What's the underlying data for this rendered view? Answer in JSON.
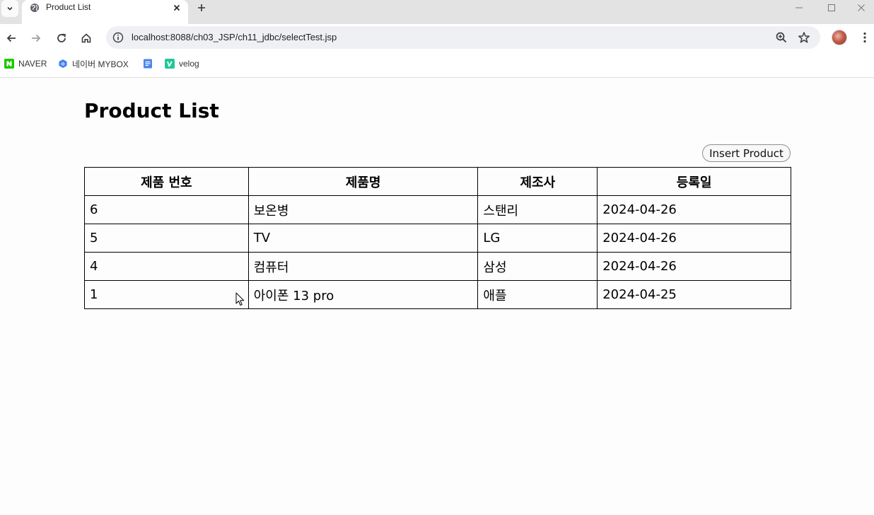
{
  "browser": {
    "tab_title": "Product List",
    "url": "localhost:8088/ch03_JSP/ch11_jdbc/selectTest.jsp",
    "bookmarks": [
      {
        "label": "NAVER",
        "icon": "naver-icon",
        "color": "#1ec800"
      },
      {
        "label": "네이버 MYBOX",
        "icon": "mybox-icon",
        "color": "#3d7ff2"
      },
      {
        "label": "",
        "icon": "docs-icon",
        "color": "#4a86e8"
      },
      {
        "label": "velog",
        "icon": "velog-icon",
        "color": "#20c997"
      }
    ]
  },
  "page": {
    "title": "Product List",
    "insert_button": "Insert Product",
    "table": {
      "headers": [
        "제품 번호",
        "제품명",
        "제조사",
        "등록일"
      ],
      "rows": [
        [
          "6",
          "보온병",
          "스탠리",
          "2024-04-26"
        ],
        [
          "5",
          "TV",
          "LG",
          "2024-04-26"
        ],
        [
          "4",
          "컴퓨터",
          "삼성",
          "2024-04-26"
        ],
        [
          "1",
          "아이폰 13 pro",
          "애플",
          "2024-04-25"
        ]
      ]
    }
  }
}
